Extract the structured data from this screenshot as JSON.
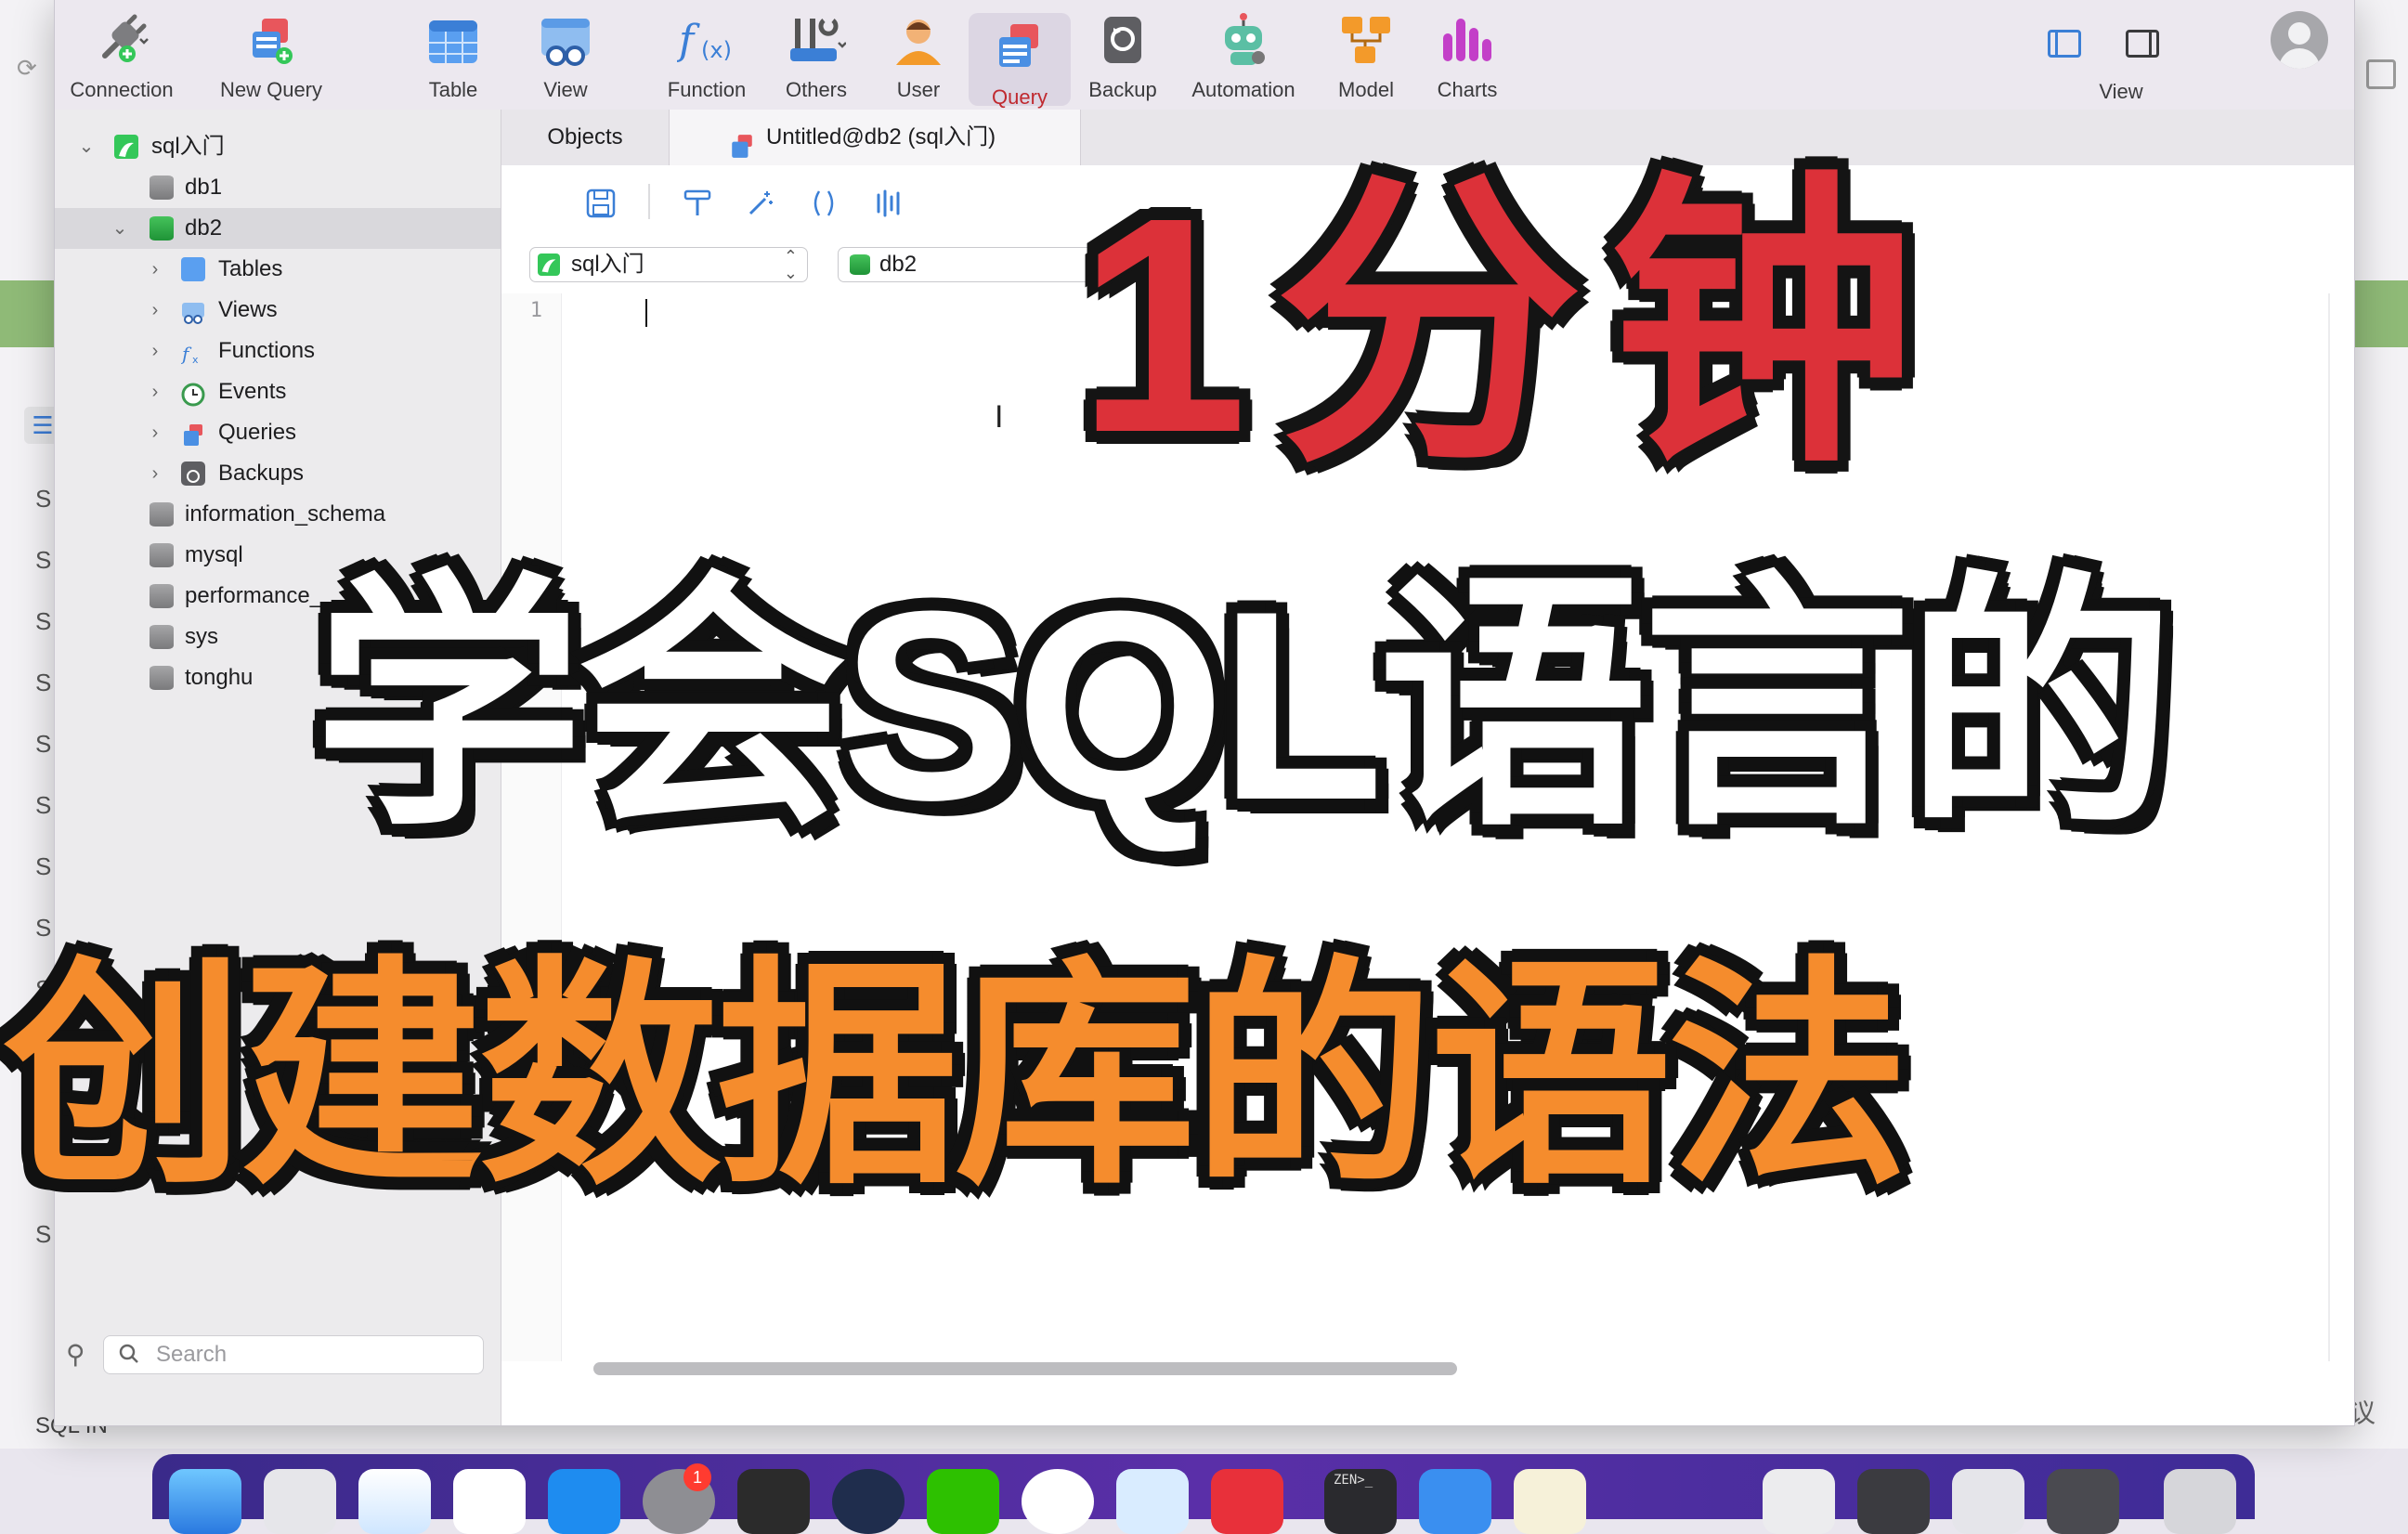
{
  "toolbar": {
    "items": [
      {
        "label": "Connection",
        "icon": "plug-icon"
      },
      {
        "label": "New Query",
        "icon": "new-query-icon"
      },
      {
        "label": "Table",
        "icon": "table-icon"
      },
      {
        "label": "View",
        "icon": "view-icon"
      },
      {
        "label": "Function",
        "icon": "function-icon"
      },
      {
        "label": "Others",
        "icon": "tools-icon"
      },
      {
        "label": "User",
        "icon": "user-icon"
      },
      {
        "label": "Query",
        "icon": "query-icon",
        "active": true
      },
      {
        "label": "Backup",
        "icon": "backup-icon"
      },
      {
        "label": "Automation",
        "icon": "robot-icon"
      },
      {
        "label": "Model",
        "icon": "model-icon"
      },
      {
        "label": "Charts",
        "icon": "charts-icon"
      }
    ],
    "view_label": "View"
  },
  "sidebar": {
    "connection": "sql入门",
    "items": [
      {
        "label": "db1"
      },
      {
        "label": "db2"
      },
      {
        "label": "Tables"
      },
      {
        "label": "Views"
      },
      {
        "label": "Functions"
      },
      {
        "label": "Events"
      },
      {
        "label": "Queries"
      },
      {
        "label": "Backups"
      },
      {
        "label": "information_schema"
      },
      {
        "label": "mysql"
      },
      {
        "label": "performance_"
      },
      {
        "label": "sys"
      },
      {
        "label": "tonghu"
      }
    ],
    "search_placeholder": "Search"
  },
  "tabs": {
    "objects": "Objects",
    "query_tab": "Untitled@db2 (sql入门)"
  },
  "editor": {
    "connection_select": "sql入门",
    "database_select": "db2",
    "line_number": "1"
  },
  "background": {
    "bottom_text": "SQL IN",
    "right_text": "议",
    "list_letters": [
      "S",
      "S",
      "S",
      "S",
      "S",
      "S",
      "S",
      "S",
      "S",
      "S",
      "S",
      "S",
      "S"
    ]
  },
  "overlay": {
    "line1": "1分钟",
    "line2": "学会SQL语言的",
    "line3": "创建数据库的语法"
  },
  "dock": {
    "badge": "1",
    "terminal_text": "ZEN>_"
  },
  "colors": {
    "accent_red": "#dc3139",
    "accent_orange": "#f58c2d",
    "selection_green": "#1f9337"
  }
}
